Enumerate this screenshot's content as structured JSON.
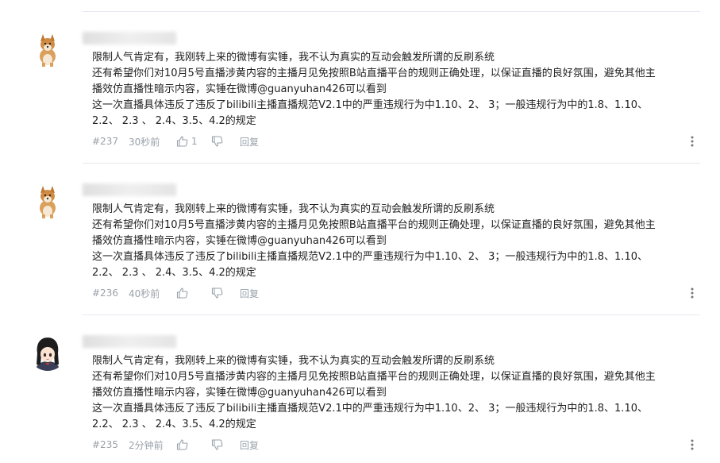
{
  "comments": [
    {
      "floor": "#237",
      "time": "30秒前",
      "likes": "1",
      "reply_label": "回复",
      "avatar": "shiba-dog-avatar",
      "lines": [
        "限制人气肯定有，我刚转上来的微博有实锤，我不认为真实的互动会触发所谓的反刷系统",
        "还有希望你们对10月5号直播涉黄内容的主播月见免按照B站直播平台的规则正确处理，以保证直播的良好氛围，避免其他主",
        "播效仿直播性暗示内容，实锤在微博@guanyuhan426可以看到",
        "这一次直播具体违反了违反了bilibili主播直播规范V2.1中的严重违规行为中1.10、2、 3；一般违规行为中的1.8、1.10、",
        "2.2、 2.3 、 2.4、3.5、4.2的规定"
      ]
    },
    {
      "floor": "#236",
      "time": "40秒前",
      "likes": "",
      "reply_label": "回复",
      "avatar": "shiba-dog-avatar",
      "lines": [
        "限制人气肯定有，我刚转上来的微博有实锤，我不认为真实的互动会触发所谓的反刷系统",
        "还有希望你们对10月5号直播涉黄内容的主播月见免按照B站直播平台的规则正确处理，以保证直播的良好氛围，避免其他主",
        "播效仿直播性暗示内容，实锤在微博@guanyuhan426可以看到",
        "这一次直播具体违反了违反了bilibili主播直播规范V2.1中的严重违规行为中1.10、2、 3；一般违规行为中的1.8、1.10、",
        "2.2、 2.3 、 2.4、3.5、4.2的规定"
      ]
    },
    {
      "floor": "#235",
      "time": "2分钟前",
      "likes": "",
      "reply_label": "回复",
      "avatar": "anime-girl-avatar",
      "lines": [
        "限制人气肯定有，我刚转上来的微博有实锤，我不认为真实的互动会触发所谓的反刷系统",
        "还有希望你们对10月5号直播涉黄内容的主播月见免按照B站直播平台的规则正确处理，以保证直播的良好氛围，避免其他主",
        "播效仿直播性暗示内容，实锤在微博@guanyuhan426可以看到",
        "这一次直播具体违反了违反了bilibili主播直播规范V2.1中的严重违规行为中1.10、2、 3；一般违规行为中的1.8、1.10、",
        "2.2、 2.3 、 2.4、3.5、4.2的规定"
      ]
    }
  ],
  "colors": {
    "text": "#222222",
    "meta": "#99a2aa",
    "divider": "#e5e9ef"
  },
  "icons": {
    "like": "thumbs-up-icon",
    "dislike": "thumbs-down-icon",
    "more": "more-vertical-icon"
  }
}
